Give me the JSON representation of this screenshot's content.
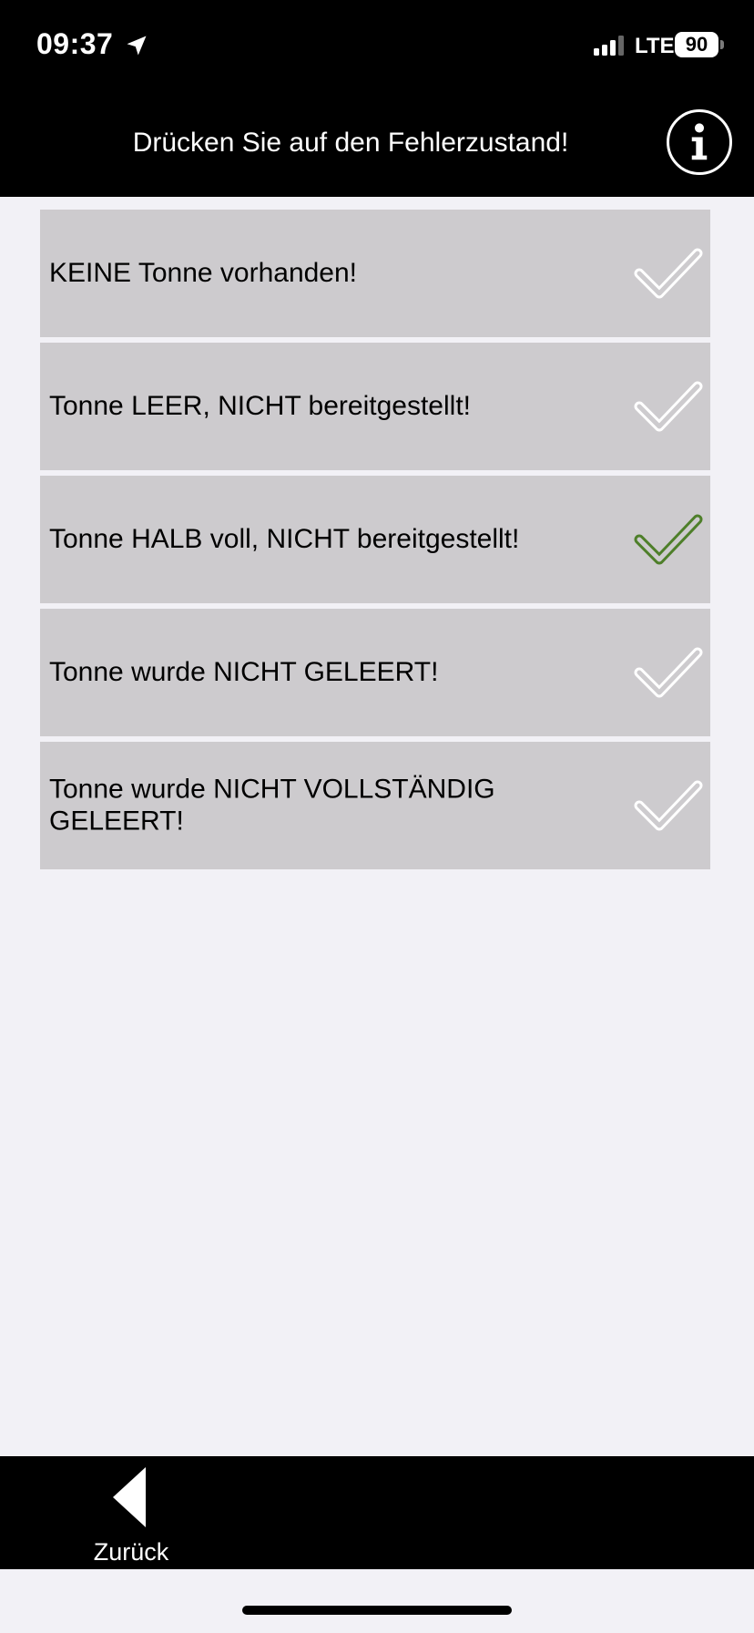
{
  "status_bar": {
    "time": "09:37",
    "network": "LTE",
    "battery": "90"
  },
  "header": {
    "title": "Drücken Sie auf den Fehlerzustand!",
    "info_icon": "info-icon"
  },
  "items": [
    {
      "label": "KEINE Tonne vorhanden!",
      "checked": false
    },
    {
      "label": "Tonne LEER, NICHT bereitgestellt!",
      "checked": false
    },
    {
      "label": "Tonne HALB voll, NICHT bereitgestellt!",
      "checked": true
    },
    {
      "label": "Tonne wurde NICHT GELEERT!",
      "checked": false
    },
    {
      "label": "Tonne wurde NICHT VOLLSTÄNDIG GELEERT!",
      "checked": false
    }
  ],
  "footer": {
    "back_label": "Zurück",
    "back_icon": "back-arrow-icon"
  },
  "colors": {
    "check_selected": "#4e7f2a",
    "check_unselected": "#ffffff",
    "item_background": "#cdcbce",
    "bar_background": "#000000",
    "page_background": "#f2f1f6"
  }
}
